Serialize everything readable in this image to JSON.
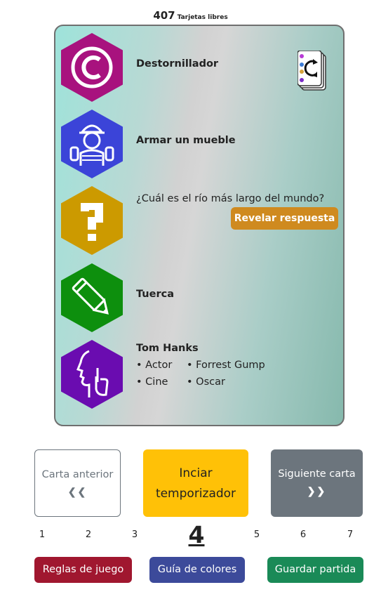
{
  "header": {
    "count": "407",
    "label": "Tarjetas libres"
  },
  "card": {
    "rows": [
      {
        "title": "Destornillador",
        "icon": "copyright-icon",
        "color": "#a8127e"
      },
      {
        "title": "Armar un mueble",
        "icon": "mime-icon",
        "color": "#3b44d8"
      },
      {
        "question": "¿Cuál es el río más largo del mundo?",
        "reveal": "Revelar respuesta",
        "icon": "question-mark-icon",
        "color": "#cc9a00"
      },
      {
        "title": "Tuerca",
        "icon": "pencil-icon",
        "color": "#0d8f0d"
      },
      {
        "title": "Tom Hanks",
        "bullets": [
          "• Actor",
          "• Forrest Gump",
          "• Cine",
          "• Oscar"
        ],
        "icon": "silence-icon",
        "color": "#6a0cb0"
      }
    ]
  },
  "controls": {
    "prev": "Carta anterior",
    "timer": "Inciar temporizador",
    "next": "Siguiente carta"
  },
  "pagination": {
    "pages": [
      "1",
      "2",
      "3",
      "4",
      "5",
      "6",
      "7"
    ],
    "current": "4"
  },
  "footer": {
    "rules": "Reglas de juego",
    "colors": "Guía de colores",
    "save": "Guardar partida"
  }
}
